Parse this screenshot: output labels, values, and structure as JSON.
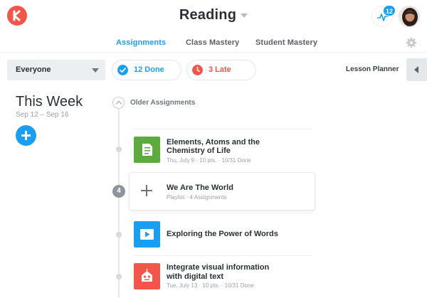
{
  "header": {
    "title": "Reading",
    "notification_count": "12"
  },
  "tabs": [
    {
      "label": "Assignments",
      "active": true
    },
    {
      "label": "Class Mastery",
      "active": false
    },
    {
      "label": "Student Mastery",
      "active": false
    }
  ],
  "filters": {
    "audience": "Everyone",
    "done_label": "12 Done",
    "late_label": "3 Late",
    "lesson_planner": "Lesson Planner"
  },
  "week": {
    "title": "This Week",
    "range": "Sep 12 – Sep 16"
  },
  "timeline": {
    "older_label": "Older Assignments",
    "playlist_count": "4"
  },
  "items": [
    {
      "title_line1": "Elements, Atoms and the",
      "title_line2": "Chemistry of Life",
      "meta": "Thu, July 9  ·  10 pts.  ·  10/31 Done",
      "icon": "document-icon",
      "color": "#5daa3f"
    },
    {
      "title_line1": "We Are The World",
      "meta": "Playlist  ·  4 Assignments",
      "icon": "plus-icon"
    },
    {
      "title_line1": "Exploring the Power of Words",
      "meta": "",
      "icon": "video-play-icon",
      "color": "#1a9ff0"
    },
    {
      "title_line1": "Integrate visual information",
      "title_line2": "with digital text",
      "meta": "Tue, July 13  ·  10 pts.  ·  10/31 Done",
      "icon": "robot-icon",
      "color": "#f2554a"
    }
  ],
  "colors": {
    "accent": "#1a9ff0",
    "danger": "#f2554a",
    "success": "#5daa3f"
  }
}
